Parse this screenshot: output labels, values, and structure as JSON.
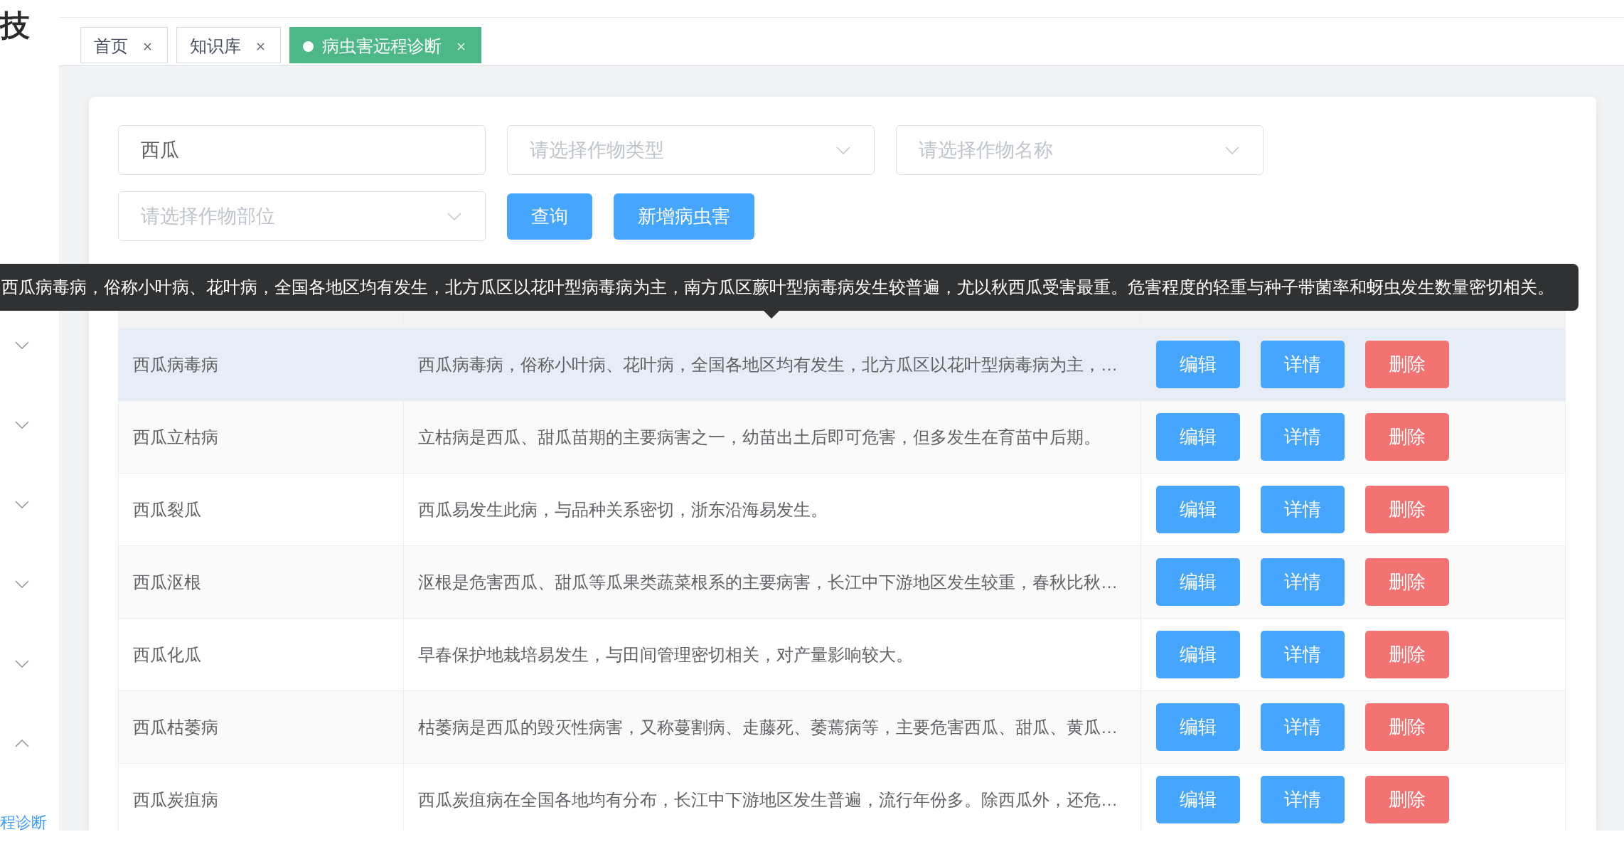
{
  "sidebar": {
    "logo": "技",
    "menus": [
      {
        "expanded": false
      },
      {
        "expanded": false
      },
      {
        "expanded": false
      },
      {
        "expanded": false
      },
      {
        "expanded": false
      },
      {
        "expanded": true,
        "children": [
          {
            "label": "程诊断",
            "selected": true
          }
        ]
      }
    ]
  },
  "tabs": [
    {
      "label": "首页",
      "selected": false
    },
    {
      "label": "知识库",
      "selected": false
    },
    {
      "label": "病虫害远程诊断",
      "selected": true
    }
  ],
  "filters": [
    {
      "kind": "input",
      "value": "西瓜"
    },
    {
      "kind": "select",
      "placeholder": "请选择作物类型"
    },
    {
      "kind": "select",
      "placeholder": "请选择作物名称"
    },
    {
      "kind": "select",
      "placeholder": "请选择作物部位"
    }
  ],
  "buttons": [
    "查询",
    "新增病虫害"
  ],
  "table": {
    "rows": [
      {
        "name": "西瓜病毒病",
        "description": "西瓜病毒病，俗称小叶病、花叶病，全国各地区均有发生，北方瓜区以花叶型病毒病为主，…",
        "hovered": true,
        "actions": [
          {
            "kind": "edit",
            "label": "编辑"
          },
          {
            "kind": "view",
            "label": "详情"
          },
          {
            "kind": "delete",
            "label": "删除"
          }
        ]
      },
      {
        "name": "西瓜立枯病",
        "description": "立枯病是西瓜、甜瓜苗期的主要病害之一，幼苗出土后即可危害，但多发生在育苗中后期。",
        "hovered": false,
        "actions": [
          {
            "kind": "edit",
            "label": "编辑"
          },
          {
            "kind": "view",
            "label": "详情"
          },
          {
            "kind": "delete",
            "label": "删除"
          }
        ]
      },
      {
        "name": "西瓜裂瓜",
        "description": "西瓜易发生此病，与品种关系密切，浙东沿海易发生。",
        "hovered": false,
        "actions": [
          {
            "kind": "edit",
            "label": "编辑"
          },
          {
            "kind": "view",
            "label": "详情"
          },
          {
            "kind": "delete",
            "label": "删除"
          }
        ]
      },
      {
        "name": "西瓜沤根",
        "description": "沤根是危害西瓜、甜瓜等瓜果类蔬菜根系的主要病害，长江中下游地区发生较重，春秋比秋…",
        "hovered": false,
        "actions": [
          {
            "kind": "edit",
            "label": "编辑"
          },
          {
            "kind": "view",
            "label": "详情"
          },
          {
            "kind": "delete",
            "label": "删除"
          }
        ]
      },
      {
        "name": "西瓜化瓜",
        "description": "早春保护地栽培易发生，与田间管理密切相关，对产量影响较大。",
        "hovered": false,
        "actions": [
          {
            "kind": "edit",
            "label": "编辑"
          },
          {
            "kind": "view",
            "label": "详情"
          },
          {
            "kind": "delete",
            "label": "删除"
          }
        ]
      },
      {
        "name": "西瓜枯萎病",
        "description": "枯萎病是西瓜的毁灭性病害，又称蔓割病、走藤死、萎蔫病等，主要危害西瓜、甜瓜、黄瓜…",
        "hovered": false,
        "actions": [
          {
            "kind": "edit",
            "label": "编辑"
          },
          {
            "kind": "view",
            "label": "详情"
          },
          {
            "kind": "delete",
            "label": "删除"
          }
        ]
      },
      {
        "name": "西瓜炭疽病",
        "description": "西瓜炭疽病在全国各地均有分布，长江中下游地区发生普遍，流行年份多。除西瓜外，还危…",
        "hovered": false,
        "actions": [
          {
            "kind": "edit",
            "label": "编辑"
          },
          {
            "kind": "view",
            "label": "详情"
          },
          {
            "kind": "delete",
            "label": "删除"
          }
        ]
      }
    ]
  },
  "tooltip": {
    "text": "西瓜病毒病，俗称小叶病、花叶病，全国各地区均有发生，北方瓜区以花叶型病毒病为主，南方瓜区蕨叶型病毒病发生较普遍，尤以秋西瓜受害最重。危害程度的轻重与种子带菌率和蚜虫发生数量密切相关。"
  }
}
